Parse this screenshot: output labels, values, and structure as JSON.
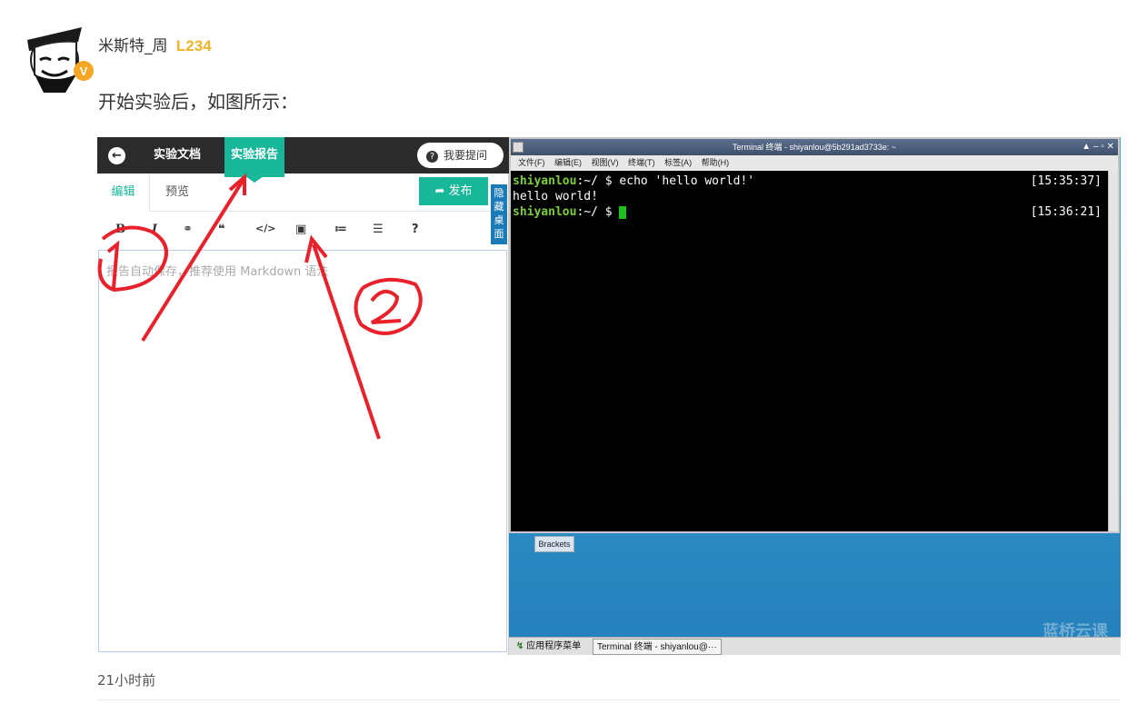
{
  "post": {
    "username": "米斯特_周",
    "level": "L234",
    "text": "开始实验后，如图所示：",
    "time": "21小时前"
  },
  "editor": {
    "tabs": {
      "doc": "实验文档",
      "report": "实验报告"
    },
    "ask_button": "我要提问",
    "subtabs": {
      "edit": "编辑",
      "preview": "预览"
    },
    "publish": "发布",
    "toolbar": [
      "B",
      "I",
      "⚭",
      "❝",
      "</>",
      "▣",
      "≔",
      "☰",
      "?"
    ],
    "placeholder": "报告自动保存，推荐使用 Markdown 语法",
    "hide_desktop": "隐藏桌面"
  },
  "terminal": {
    "title": "Terminal 终端 - shiyanlou@5b291ad3733e: ~",
    "menu": [
      "文件(F)",
      "编辑(E)",
      "视图(V)",
      "终端(T)",
      "标签(A)",
      "帮助(H)"
    ],
    "prompt_user": "shiyanlou",
    "prompt_path": ":~/ $ ",
    "cmd1": "echo 'hello world!'",
    "ts1": "[15:35:37]",
    "out1": "hello world!",
    "ts2": "[15:36:21]"
  },
  "desktop": {
    "brackets": "Brackets",
    "apps_menu": "应用程序菜单",
    "task_terminal": "Terminal 终端 - shiyanlou@···",
    "watermark": "蓝桥云课"
  },
  "colors": {
    "accent": "#19b79a",
    "annotation": "#e8212b",
    "level": "#f0b429"
  }
}
